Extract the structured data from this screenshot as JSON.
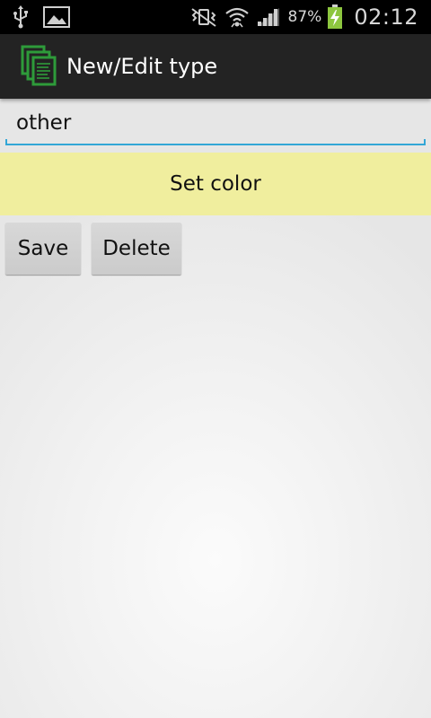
{
  "status_bar": {
    "icons": [
      "usb-icon",
      "image-notification-icon",
      "vibrate-mute-icon",
      "wifi-icon",
      "signal-icon",
      "battery-charging-icon"
    ],
    "battery_percent": "87%",
    "time": "02:12"
  },
  "action_bar": {
    "app_icon": "documents-icon",
    "title": "New/Edit type"
  },
  "form": {
    "name_value": "other",
    "set_color_label": "Set color",
    "save_label": "Save",
    "delete_label": "Delete"
  },
  "colors": {
    "status_bar_bg": "#000000",
    "action_bar_bg": "#232323",
    "accent": "#33a6d6",
    "set_color_bg": "#f0ee9e",
    "button_bg": "#d1d1d1",
    "app_icon_green": "#2e9b3a"
  }
}
